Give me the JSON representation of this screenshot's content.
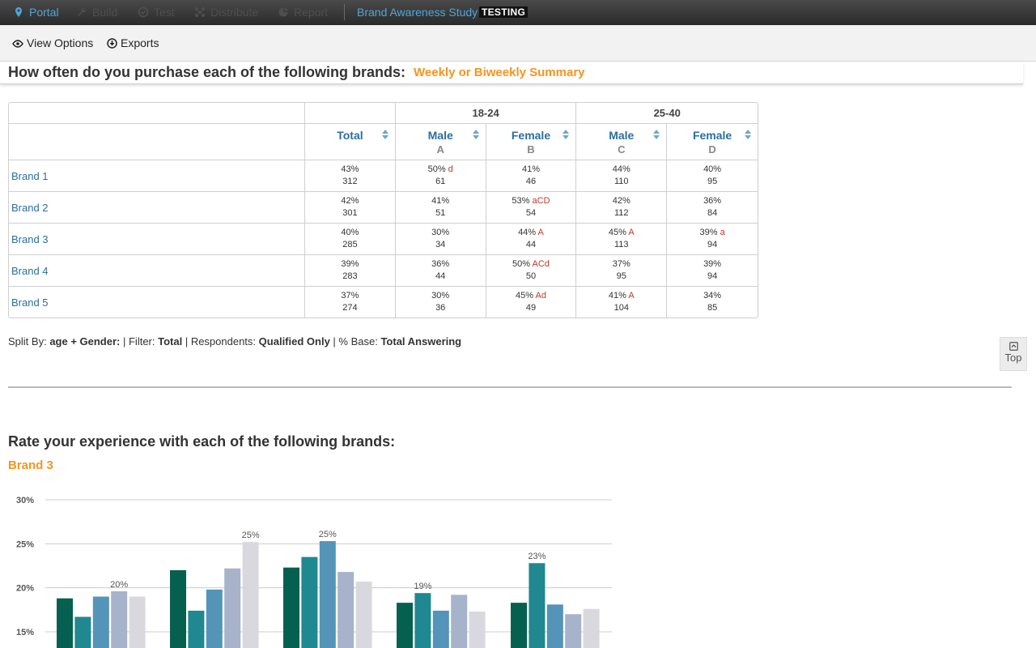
{
  "nav": {
    "items": [
      {
        "label": "Portal",
        "icon": "location-pin-icon",
        "active": true
      },
      {
        "label": "Build",
        "icon": "wrench-icon",
        "active": false
      },
      {
        "label": "Test",
        "icon": "check-circle-icon",
        "active": false
      },
      {
        "label": "Distribute",
        "icon": "distribute-icon",
        "active": false
      },
      {
        "label": "Report",
        "icon": "pie-chart-icon",
        "active": false
      }
    ],
    "study_title": "Brand Awareness Study",
    "badge": "TESTING"
  },
  "toolbar": {
    "view_options": "View Options",
    "exports": "Exports"
  },
  "q1": {
    "title": "How often do you purchase each of the following brands:",
    "subtitle": "Weekly or Biweekly Summary",
    "groups": [
      "18-24",
      "25-40"
    ],
    "columns": [
      {
        "name": "Total",
        "letter": ""
      },
      {
        "name": "Male",
        "letter": "A"
      },
      {
        "name": "Female",
        "letter": "B"
      },
      {
        "name": "Male",
        "letter": "C"
      },
      {
        "name": "Female",
        "letter": "D"
      }
    ],
    "rows": [
      {
        "label": "Brand 1",
        "cells": [
          {
            "pct": "43%",
            "sig": "",
            "n": "312"
          },
          {
            "pct": "50%",
            "sig": "d",
            "n": "61"
          },
          {
            "pct": "41%",
            "sig": "",
            "n": "46"
          },
          {
            "pct": "44%",
            "sig": "",
            "n": "110"
          },
          {
            "pct": "40%",
            "sig": "",
            "n": "95"
          }
        ]
      },
      {
        "label": "Brand 2",
        "cells": [
          {
            "pct": "42%",
            "sig": "",
            "n": "301"
          },
          {
            "pct": "41%",
            "sig": "",
            "n": "51"
          },
          {
            "pct": "53%",
            "sig": "aCD",
            "n": "54"
          },
          {
            "pct": "42%",
            "sig": "",
            "n": "112"
          },
          {
            "pct": "36%",
            "sig": "",
            "n": "84"
          }
        ]
      },
      {
        "label": "Brand 3",
        "cells": [
          {
            "pct": "40%",
            "sig": "",
            "n": "285"
          },
          {
            "pct": "30%",
            "sig": "",
            "n": "34"
          },
          {
            "pct": "44%",
            "sig": "A",
            "n": "44"
          },
          {
            "pct": "45%",
            "sig": "A",
            "n": "113"
          },
          {
            "pct": "39%",
            "sig": "a",
            "n": "94"
          }
        ]
      },
      {
        "label": "Brand 4",
        "cells": [
          {
            "pct": "39%",
            "sig": "",
            "n": "283"
          },
          {
            "pct": "36%",
            "sig": "",
            "n": "44"
          },
          {
            "pct": "50%",
            "sig": "ACd",
            "n": "50"
          },
          {
            "pct": "37%",
            "sig": "",
            "n": "95"
          },
          {
            "pct": "39%",
            "sig": "",
            "n": "94"
          }
        ]
      },
      {
        "label": "Brand 5",
        "cells": [
          {
            "pct": "37%",
            "sig": "",
            "n": "274"
          },
          {
            "pct": "30%",
            "sig": "",
            "n": "36"
          },
          {
            "pct": "45%",
            "sig": "Ad",
            "n": "49"
          },
          {
            "pct": "41%",
            "sig": "A",
            "n": "104"
          },
          {
            "pct": "34%",
            "sig": "",
            "n": "85"
          }
        ]
      }
    ],
    "footnote": {
      "split_by_label": "Split By:",
      "split_by_value": "age + Gender:",
      "filter_label": "Filter:",
      "filter_value": "Total",
      "respondents_label": "Respondents:",
      "respondents_value": "Qualified Only",
      "base_label": "% Base:",
      "base_value": "Total Answering"
    }
  },
  "top_button": "Top",
  "q2": {
    "title": "Rate your experience with each of the following brands:",
    "subtitle": "Brand 3"
  },
  "chart_data": {
    "type": "bar",
    "y_tick_labels": [
      "30%",
      "25%",
      "20%",
      "15%"
    ],
    "ylim": [
      15,
      30
    ],
    "grid": true,
    "series_colors": [
      "#05604f",
      "#1f8890",
      "#5394b8",
      "#a6b3cb",
      "#dad8df"
    ],
    "groups": [
      {
        "values": [
          18.8,
          16.7,
          19.0,
          19.6,
          19.0
        ],
        "labels": [
          "",
          "",
          "",
          "20%",
          ""
        ]
      },
      {
        "values": [
          22.0,
          17.4,
          19.8,
          22.2,
          25.2
        ],
        "labels": [
          "",
          "",
          "",
          "",
          "25%"
        ]
      },
      {
        "values": [
          22.3,
          23.5,
          25.3,
          21.8,
          20.7
        ],
        "labels": [
          "",
          "",
          "25%",
          "",
          ""
        ]
      },
      {
        "values": [
          18.3,
          19.4,
          17.4,
          19.2,
          17.3
        ],
        "labels": [
          "",
          "19%",
          "",
          "",
          ""
        ]
      },
      {
        "values": [
          18.3,
          22.8,
          18.1,
          17.0,
          17.6
        ],
        "labels": [
          "",
          "23%",
          "",
          "",
          ""
        ]
      }
    ]
  },
  "colors": {
    "accent_orange": "#f7941d",
    "link_blue": "#2a6f9e",
    "significance_red": "#c0392b",
    "nav_active": "#4fa6d8"
  }
}
